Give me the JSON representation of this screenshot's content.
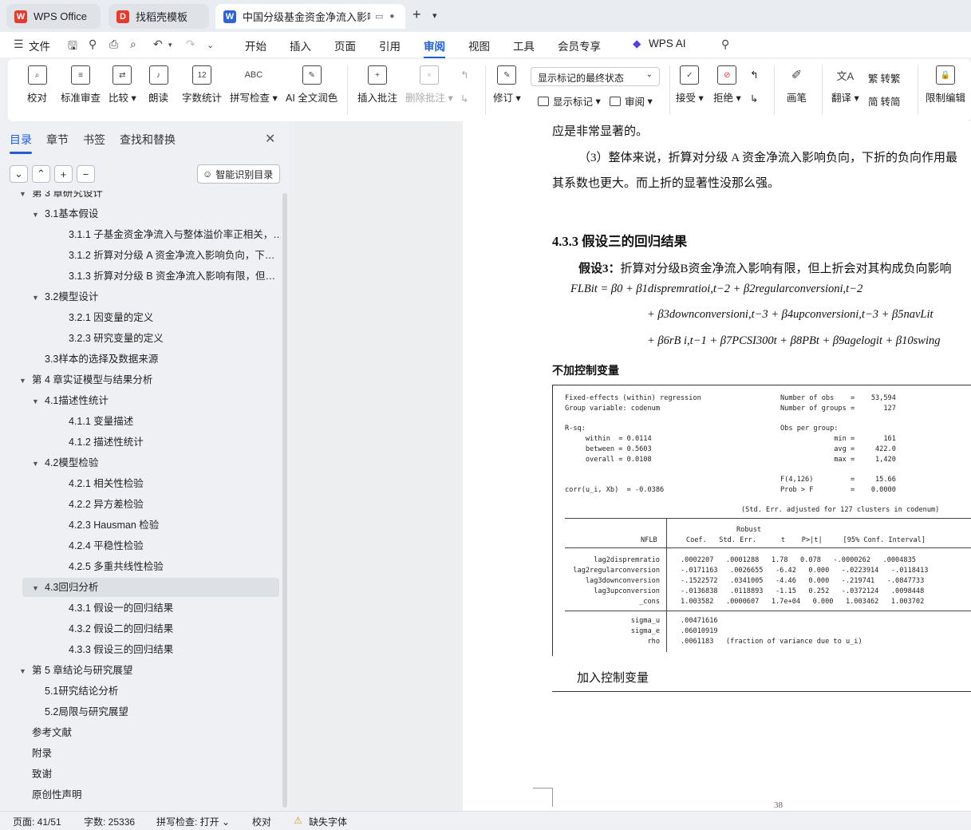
{
  "tabs": [
    {
      "label": "WPS Office"
    },
    {
      "label": "找稻壳模板"
    },
    {
      "label": "中国分级基金资金净流入影响因"
    }
  ],
  "menu": {
    "file": "文件",
    "items": [
      "开始",
      "插入",
      "页面",
      "引用",
      "审阅",
      "视图",
      "工具",
      "会员专享"
    ],
    "ai": "WPS AI"
  },
  "ribbon": {
    "proofread": "校对",
    "standard_review": "标准审查",
    "compare": "比较",
    "read_aloud": "朗读",
    "word_count": "字数统计",
    "spell_check": "拼写检查",
    "ai_polish": "AI 全文润色",
    "insert_comment": "插入批注",
    "delete_comment": "删除批注",
    "track": "修订",
    "markup_select": "显示标记的最终状态",
    "show_markup": "显示标记",
    "review_pane": "审阅",
    "accept": "接受",
    "reject": "拒绝",
    "pen": "画笔",
    "translate": "翻译",
    "to_trad": "转繁",
    "to_simp": "转简",
    "restrict": "限制编辑"
  },
  "panel": {
    "tabs": [
      "目录",
      "章节",
      "书签",
      "查找和替换"
    ],
    "ai_toc": "智能识别目录"
  },
  "toc": [
    {
      "text": "第 3 章研究设计",
      "lvl": 1,
      "tri": true
    },
    {
      "text": "3.1基本假设",
      "lvl": 2,
      "tri": true
    },
    {
      "text": "3.1.1 子基金资金净流入与整体溢价率正相关，与…",
      "lvl": 3
    },
    {
      "text": "3.1.2 折算对分级 A 资金净流入影响负向，下折…",
      "lvl": 3
    },
    {
      "text": "3.1.3 折算对分级 B 资金净流入影响有限，但上折…",
      "lvl": 3
    },
    {
      "text": "3.2模型设计",
      "lvl": 2,
      "tri": true
    },
    {
      "text": "3.2.1 因变量的定义",
      "lvl": 3
    },
    {
      "text": "3.2.3 研究变量的定义",
      "lvl": 3
    },
    {
      "text": "3.3样本的选择及数据来源",
      "lvl": 2
    },
    {
      "text": "第 4 章实证模型与结果分析",
      "lvl": 1,
      "tri": true
    },
    {
      "text": "4.1描述性统计",
      "lvl": 2,
      "tri": true
    },
    {
      "text": "4.1.1 变量描述",
      "lvl": 3
    },
    {
      "text": "4.1.2 描述性统计",
      "lvl": 3
    },
    {
      "text": "4.2模型检验",
      "lvl": 2,
      "tri": true
    },
    {
      "text": "4.2.1  相关性检验",
      "lvl": 3
    },
    {
      "text": "4.2.2  异方差检验",
      "lvl": 3
    },
    {
      "text": "4.2.3 Hausman 检验",
      "lvl": 3
    },
    {
      "text": "4.2.4  平稳性检验",
      "lvl": 3
    },
    {
      "text": "4.2.5  多重共线性检验",
      "lvl": 3
    },
    {
      "text": "4.3回归分析",
      "lvl": 2,
      "tri": true,
      "sel": true
    },
    {
      "text": "4.3.1 假设一的回归结果",
      "lvl": 3
    },
    {
      "text": "4.3.2 假设二的回归结果",
      "lvl": 3
    },
    {
      "text": "4.3.3 假设三的回归结果",
      "lvl": 3
    },
    {
      "text": "第 5 章结论与研究展望",
      "lvl": 1,
      "tri": true
    },
    {
      "text": "5.1研究结论分析",
      "lvl": 2
    },
    {
      "text": "5.2局限与研究展望",
      "lvl": 2
    },
    {
      "text": "参考文献",
      "lvl": 1
    },
    {
      "text": "附录",
      "lvl": 1
    },
    {
      "text": "致谢",
      "lvl": 1
    },
    {
      "text": "原创性声明",
      "lvl": 1
    }
  ],
  "doc": {
    "line1": "应是非常显著的。",
    "line2": "（3）整体来说，折算对分级 A 资金净流入影响负向，下折的负向作用最",
    "line3": "其系数也更大。而上折的显著性没那么强。",
    "heading": "4.3.3 假设三的回归结果",
    "hyp_label": "假设3：",
    "hyp_text": "折算对分级B资金净流入影响有限，但上折会对其构成负向影响",
    "f1": "FLBit = β0 + β1dispremratioi,t−2 + β2regularconversioni,t−2",
    "f2": "+ β3downconversioni,t−3 + β4upconversioni,t−3 + β5navLit",
    "f3": "+ β6rB i,t−1 + β7PCSI300t + β8PBt + β9agelogit + β10swing",
    "no_ctrl": "不加控制变量",
    "with_ctrl": "加入控制变量",
    "page_num": "38"
  },
  "stata": {
    "h1l": "Fixed-effects (within) regression",
    "h1r": "Number of obs    =    53,594",
    "h2l": "Group variable: codenum",
    "h2r": "Number of groups =       127",
    "rsq": "R-sq:",
    "obs": "Obs per group:",
    "w": "     within  = 0.0114",
    "wr": "             min =       161",
    "b": "     between = 0.5603",
    "br": "             avg =     422.0",
    "o": "     overall = 0.0108",
    "or": "             max =     1,420",
    "f": "F(4,126)         =     15.66",
    "corr": "corr(u_i, Xb)  = -0.0386",
    "prob": "Prob > F         =    0.0000",
    "note": "(Std. Err. adjusted for 127 clusters in codenum)",
    "robust": "Robust",
    "hdr": "NFLB       Coef.   Std. Err.      t    P>|t|     [95% Conf. Interval]",
    "rows": [
      "lag2dispremratio   .0002207   .0001288    1.78   0.078    -.0000262    .0004835",
      "lag2regularconversion  -.0171163   .0026655   -6.42   0.000    -.0223914   -.0118413",
      "lag3downconversion  -.1522572   .0341005   -4.46   0.000     -.219741   -.0847733",
      "lag3upconversion  -.0136838   .0118893   -1.15   0.252    -.0372124    .0098448",
      "_cons   1.003582   .0000607  1.7e+04   0.000     1.003462    1.003702"
    ],
    "sig": [
      "sigma_u   .00471616",
      "sigma_e   .06010919",
      "rho   .0061183   (fraction of variance due to u_i)"
    ]
  },
  "status": {
    "page": "页面: 41/51",
    "words": "字数: 25336",
    "spell": "拼写检查: 打开",
    "proof": "校对",
    "font": "缺失字体"
  }
}
